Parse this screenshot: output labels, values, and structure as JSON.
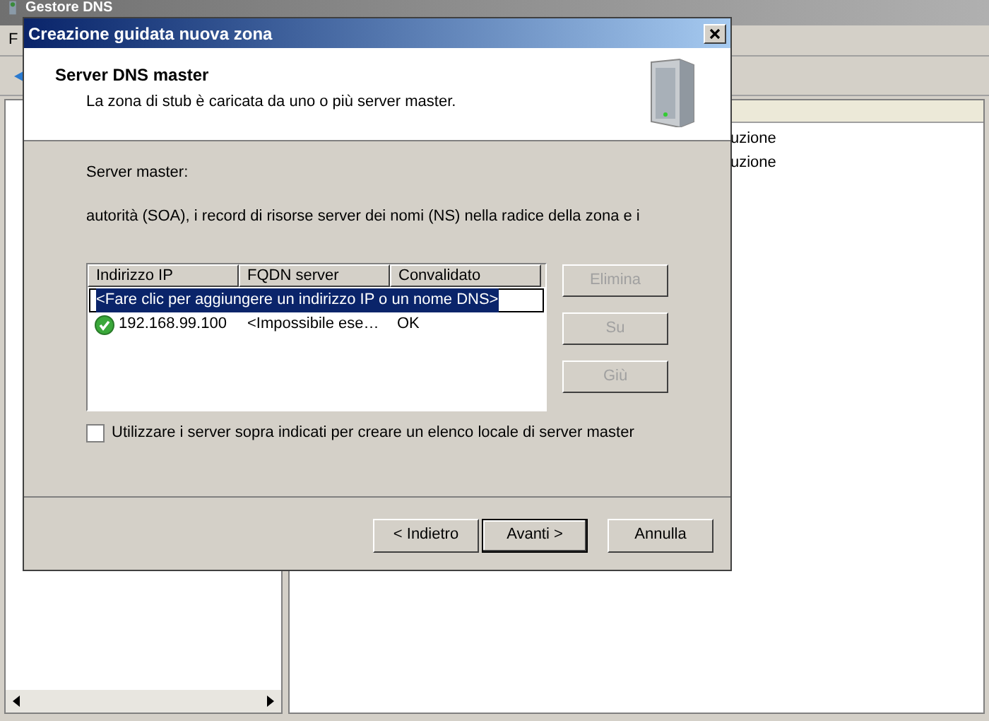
{
  "app": {
    "title": "Gestore DNS",
    "menu": [
      "F"
    ],
    "list_rows": [
      "uzione",
      "uzione"
    ]
  },
  "dialog": {
    "title": "Creazione guidata nuova zona",
    "header": {
      "title": "Server DNS master",
      "subtitle": "La zona di stub è caricata da uno o più server master."
    },
    "label": "Server master:",
    "description": "autorità (SOA), i record di risorse server dei nomi (NS) nella radice della zona e i",
    "table": {
      "columns": [
        "Indirizzo IP",
        "FQDN server",
        "Convalidato"
      ],
      "add_row": {
        "text": "<Fare clic per aggiungere un indirizzo IP o un nome DNS>",
        "selected": true
      },
      "rows": [
        {
          "ip": "192.168.99.100",
          "fqdn": "<Impossibile ese…",
          "status": "OK",
          "selected": false
        }
      ]
    },
    "side_buttons": [
      {
        "label": "Elimina",
        "disabled": true
      },
      {
        "label": "Su",
        "disabled": true
      },
      {
        "label": "Giù",
        "disabled": true
      }
    ],
    "checkbox": {
      "label": "Utilizzare i server sopra indicati per creare un elenco locale di server master",
      "checked": false
    },
    "buttons": [
      {
        "label": "< Indietro",
        "default": false
      },
      {
        "label": "Avanti >",
        "default": true
      },
      {
        "label": "Annulla",
        "default": false
      }
    ]
  }
}
